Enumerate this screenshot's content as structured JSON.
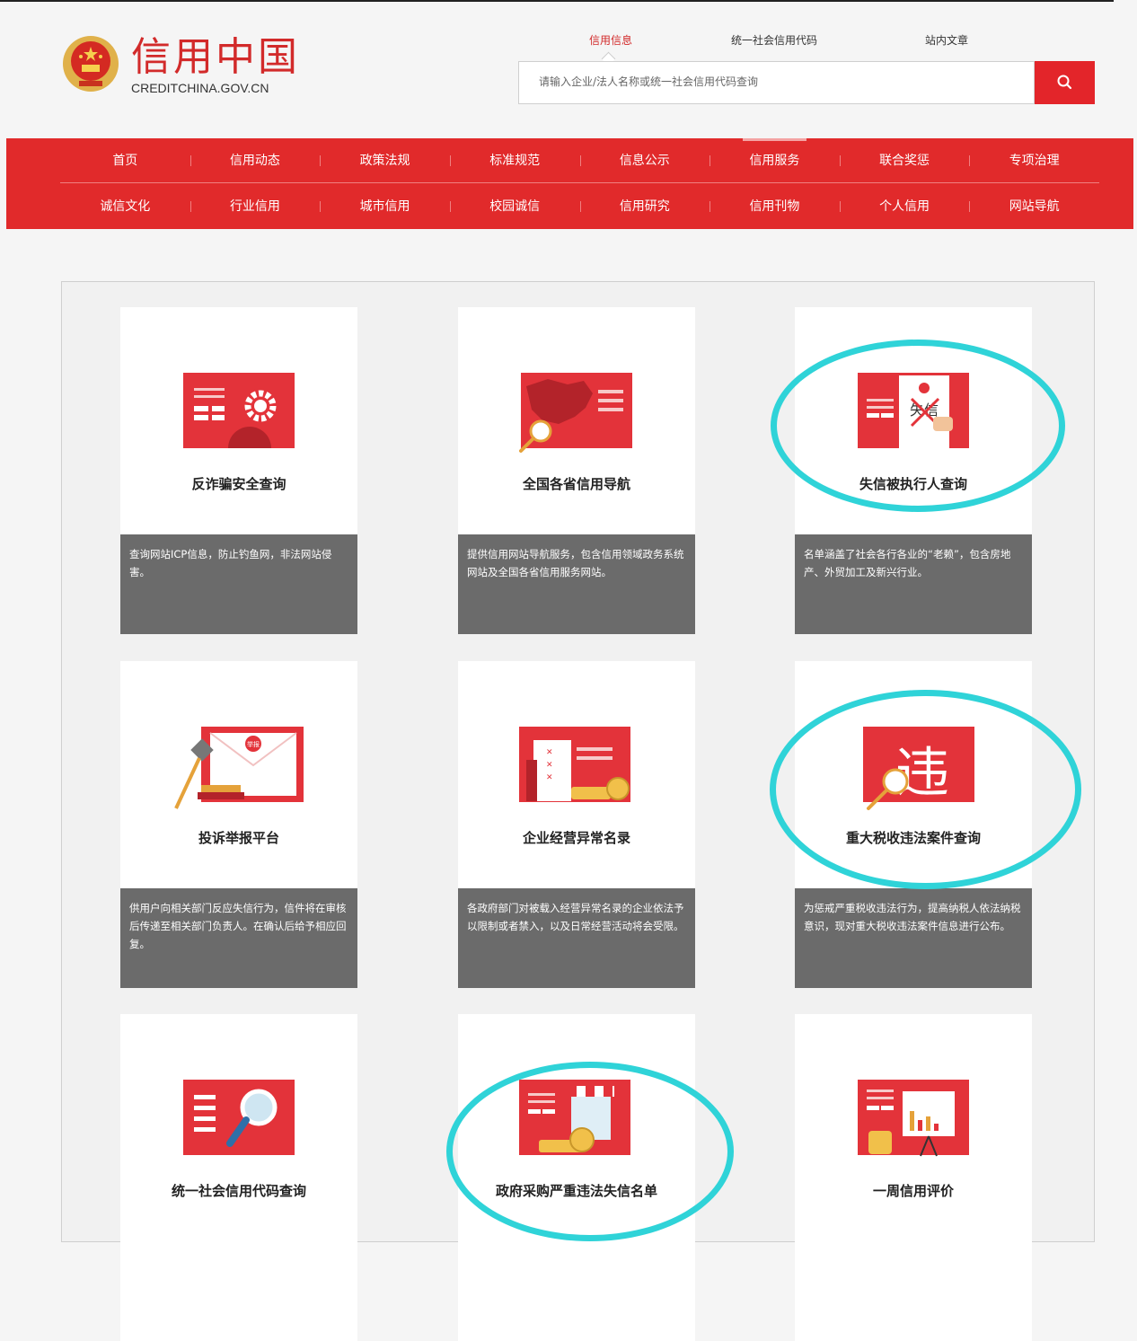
{
  "logo": {
    "cn": "信用中国",
    "en": "CREDITCHINA.GOV.CN"
  },
  "search": {
    "tabs": [
      "信用信息",
      "统一社会信用代码",
      "站内文章"
    ],
    "active_tab": "信用信息",
    "placeholder": "请输入企业/法人名称或统一社会信用代码查询",
    "button_icon": "search-icon"
  },
  "nav": {
    "row1": [
      "首页",
      "信用动态",
      "政策法规",
      "标准规范",
      "信息公示",
      "信用服务",
      "联合奖惩",
      "专项治理"
    ],
    "row2": [
      "诚信文化",
      "行业信用",
      "城市信用",
      "校园诚信",
      "信用研究",
      "信用刊物",
      "个人信用",
      "网站导航"
    ],
    "active": "信用服务"
  },
  "cards": [
    {
      "title": "反诈骗安全查询",
      "desc": "查询网站ICP信息，防止钓鱼网，非法网站侵害。",
      "icon": "gear-document-icon"
    },
    {
      "title": "全国各省信用导航",
      "desc": "提供信用网站导航服务，包含信用领域政务系统网站及全国各省信用服务网站。",
      "icon": "map-magnifier-icon"
    },
    {
      "title": "失信被执行人查询",
      "desc": "名单涵盖了社会各行各业的“老赖”，包含房地产、外贸加工及新兴行业。",
      "icon": "dishonest-document-icon",
      "icon_text": "失信"
    },
    {
      "title": "投诉举报平台",
      "desc": "供用户向相关部门反应失信行为，信件将在审核后传递至相关部门负责人。在确认后给予相应回复。",
      "icon": "envelope-gavel-icon",
      "icon_text": "举报"
    },
    {
      "title": "企业经营异常名录",
      "desc": "各政府部门对被载入经营异常名录的企业依法予以限制或者禁入，以及日常经营活动将会受限。",
      "icon": "checklist-coins-icon"
    },
    {
      "title": "重大税收违法案件查询",
      "desc": "为惩戒严重税收违法行为，提高纳税人依法纳税意识，现对重大税收违法案件信息进行公布。",
      "icon": "violation-magnifier-icon",
      "icon_text": "违"
    },
    {
      "title": "统一社会信用代码查询",
      "desc": "",
      "icon": "list-magnifier-icon"
    },
    {
      "title": "政府采购严重违法失信名单",
      "desc": "",
      "icon": "store-coins-icon"
    },
    {
      "title": "一周信用评价",
      "desc": "",
      "icon": "chart-board-icon"
    }
  ],
  "colors": {
    "brand_red": "#e12a2b",
    "highlight": "#2fd3d8",
    "desc_bg": "#6b6b6b"
  }
}
